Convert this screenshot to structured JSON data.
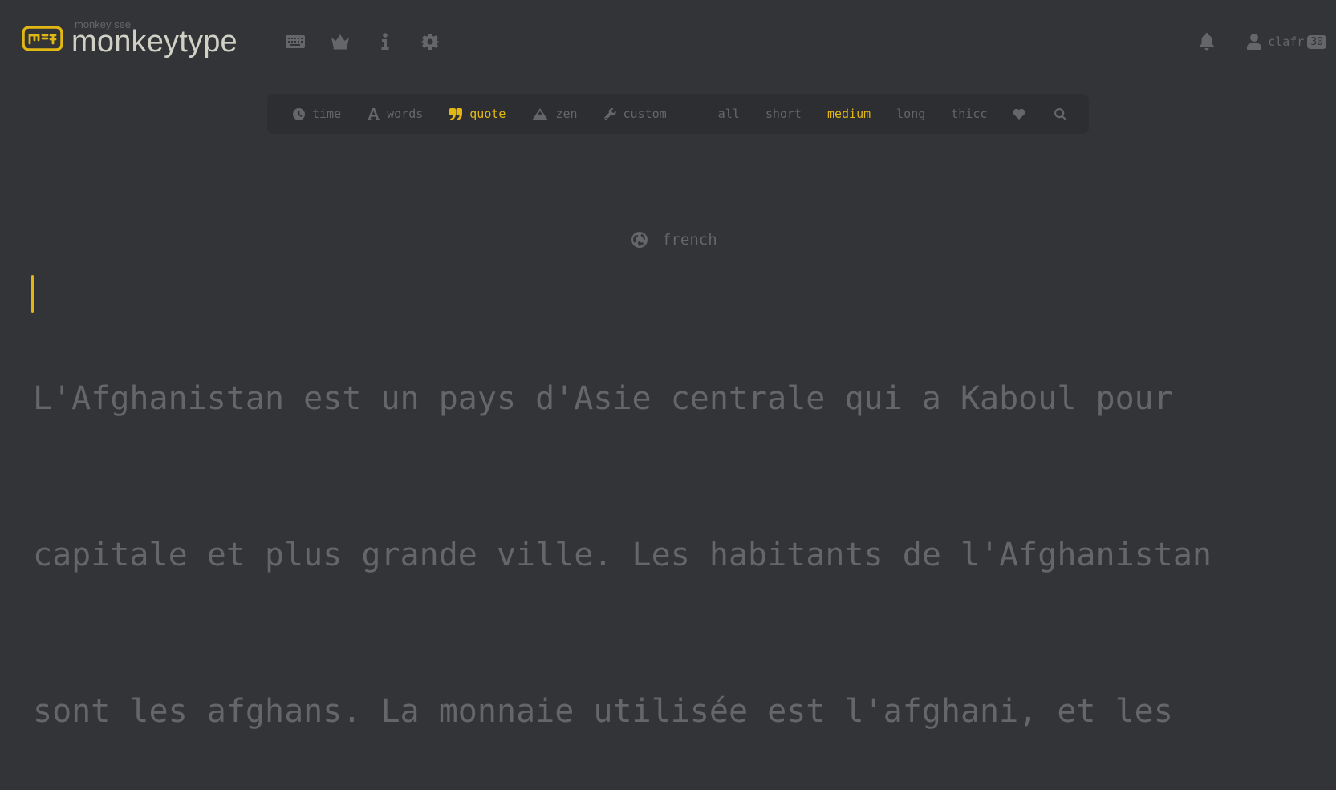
{
  "header": {
    "logo_top": "monkey see",
    "logo_main": "monkeytype",
    "nav_icons": [
      "keyboard-icon",
      "crown-icon",
      "info-icon",
      "gear-icon"
    ],
    "username": "clafr",
    "level": "30"
  },
  "config": {
    "modes": [
      {
        "label": "time",
        "icon": "clock-icon"
      },
      {
        "label": "words",
        "icon": "font-a-icon"
      },
      {
        "label": "quote",
        "icon": "quote-icon",
        "active": true
      },
      {
        "label": "zen",
        "icon": "mountain-icon"
      },
      {
        "label": "custom",
        "icon": "wrench-icon"
      }
    ],
    "lengths": [
      "all",
      "short",
      "medium",
      "long",
      "thicc"
    ],
    "active_length": "medium"
  },
  "test": {
    "language": "french",
    "lines": [
      "L'Afghanistan est un pays d'Asie centrale qui a Kaboul pour",
      "capitale et plus grande ville. Les habitants de l'Afghanistan",
      "sont les afghans. La monnaie utilisée est l'afghani, et les"
    ]
  },
  "colors": {
    "background": "#323437",
    "sub": "#646669",
    "main": "#e2b714",
    "text": "#d1d0c5"
  }
}
